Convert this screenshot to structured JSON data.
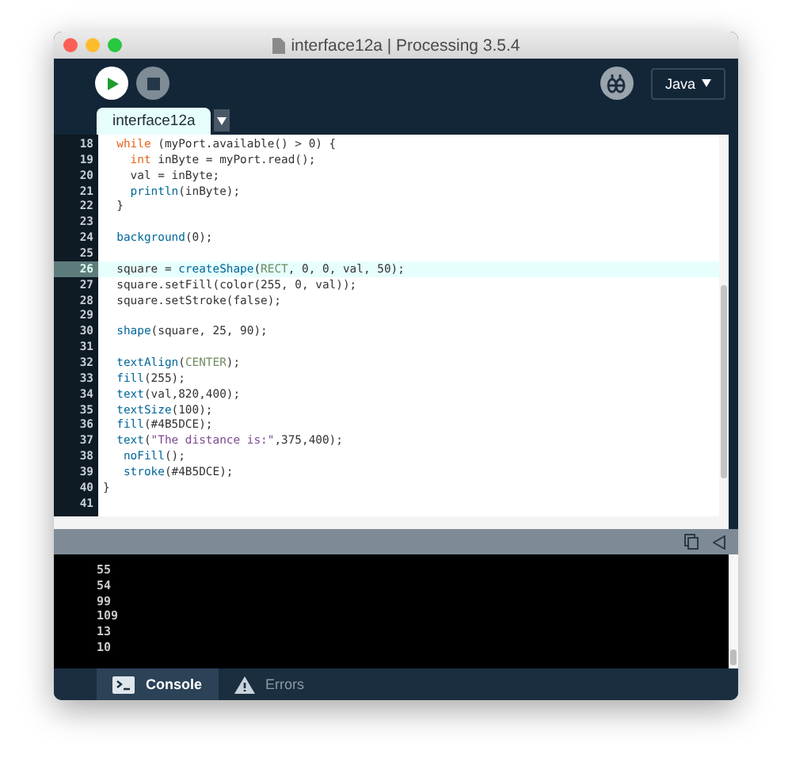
{
  "window": {
    "title": "interface12a | Processing 3.5.4"
  },
  "toolbar": {
    "mode": "Java"
  },
  "tabs": [
    {
      "label": "interface12a",
      "selected": true
    }
  ],
  "editor": {
    "lines": [
      {
        "number": "18",
        "current": false,
        "tokens": [
          {
            "text": "  while",
            "kind": "keyword"
          },
          {
            "text": " (myPort.available() > 0) {",
            "kind": "plain"
          }
        ]
      },
      {
        "number": "19",
        "current": false,
        "tokens": [
          {
            "text": "    int",
            "kind": "keyword"
          },
          {
            "text": " inByte = myPort.read();",
            "kind": "plain"
          }
        ]
      },
      {
        "number": "20",
        "current": false,
        "tokens": [
          {
            "text": "    val = inByte;",
            "kind": "plain"
          }
        ]
      },
      {
        "number": "21",
        "current": false,
        "tokens": [
          {
            "text": "    println",
            "kind": "function"
          },
          {
            "text": "(inByte);",
            "kind": "plain"
          }
        ]
      },
      {
        "number": "22",
        "current": false,
        "tokens": [
          {
            "text": "  }",
            "kind": "plain"
          }
        ]
      },
      {
        "number": "23",
        "current": false
      },
      {
        "number": "24",
        "current": false,
        "tokens": [
          {
            "text": "  background",
            "kind": "function"
          },
          {
            "text": "(0);",
            "kind": "plain"
          }
        ]
      },
      {
        "number": "25",
        "current": false
      },
      {
        "number": "26",
        "current": true,
        "tokens": [
          {
            "text": "  square = ",
            "kind": "plain"
          },
          {
            "text": "createShape",
            "kind": "function"
          },
          {
            "text": "(",
            "kind": "plain"
          },
          {
            "text": "RECT",
            "kind": "constant"
          },
          {
            "text": ", 0, 0, val, 50);",
            "kind": "plain"
          }
        ]
      },
      {
        "number": "27",
        "current": false,
        "tokens": [
          {
            "text": "  square.setFill(color(255, 0, val));",
            "kind": "plain"
          }
        ]
      },
      {
        "number": "28",
        "current": false,
        "tokens": [
          {
            "text": "  square.setStroke(false);",
            "kind": "plain"
          }
        ]
      },
      {
        "number": "29",
        "current": false
      },
      {
        "number": "30",
        "current": false,
        "tokens": [
          {
            "text": "  shape",
            "kind": "function"
          },
          {
            "text": "(square, 25, 90);",
            "kind": "plain"
          }
        ]
      },
      {
        "number": "31",
        "current": false
      },
      {
        "number": "32",
        "current": false,
        "tokens": [
          {
            "text": "  textAlign",
            "kind": "function"
          },
          {
            "text": "(",
            "kind": "plain"
          },
          {
            "text": "CENTER",
            "kind": "constant"
          },
          {
            "text": ");",
            "kind": "plain"
          }
        ]
      },
      {
        "number": "33",
        "current": false,
        "tokens": [
          {
            "text": "  fill",
            "kind": "function"
          },
          {
            "text": "(255);",
            "kind": "plain"
          }
        ]
      },
      {
        "number": "34",
        "current": false,
        "tokens": [
          {
            "text": "  text",
            "kind": "function"
          },
          {
            "text": "(val,820,400);",
            "kind": "plain"
          }
        ]
      },
      {
        "number": "35",
        "current": false,
        "tokens": [
          {
            "text": "  textSize",
            "kind": "function"
          },
          {
            "text": "(100);",
            "kind": "plain"
          }
        ]
      },
      {
        "number": "36",
        "current": false,
        "tokens": [
          {
            "text": "  fill",
            "kind": "function"
          },
          {
            "text": "(#4B5DCE);",
            "kind": "plain"
          }
        ]
      },
      {
        "number": "37",
        "current": false,
        "tokens": [
          {
            "text": "  text",
            "kind": "function"
          },
          {
            "text": "(",
            "kind": "plain"
          },
          {
            "text": "\"The distance is:\"",
            "kind": "string"
          },
          {
            "text": ",375,400);",
            "kind": "plain"
          }
        ]
      },
      {
        "number": "38",
        "current": false,
        "tokens": [
          {
            "text": "   noFill",
            "kind": "function"
          },
          {
            "text": "();",
            "kind": "plain"
          }
        ]
      },
      {
        "number": "39",
        "current": false,
        "tokens": [
          {
            "text": "   stroke",
            "kind": "function"
          },
          {
            "text": "(#4B5DCE);",
            "kind": "plain"
          }
        ]
      },
      {
        "number": "40",
        "current": false,
        "tokens": [
          {
            "text": "}",
            "kind": "plain"
          }
        ]
      },
      {
        "number": "41",
        "current": false
      }
    ]
  },
  "console": {
    "lines": [
      "55",
      "54",
      "99",
      "109",
      "13",
      "10"
    ]
  },
  "bottom_tabs": [
    {
      "label": "Console",
      "kind": "console",
      "selected": true
    },
    {
      "label": "Errors",
      "kind": "errors",
      "selected": false
    }
  ]
}
